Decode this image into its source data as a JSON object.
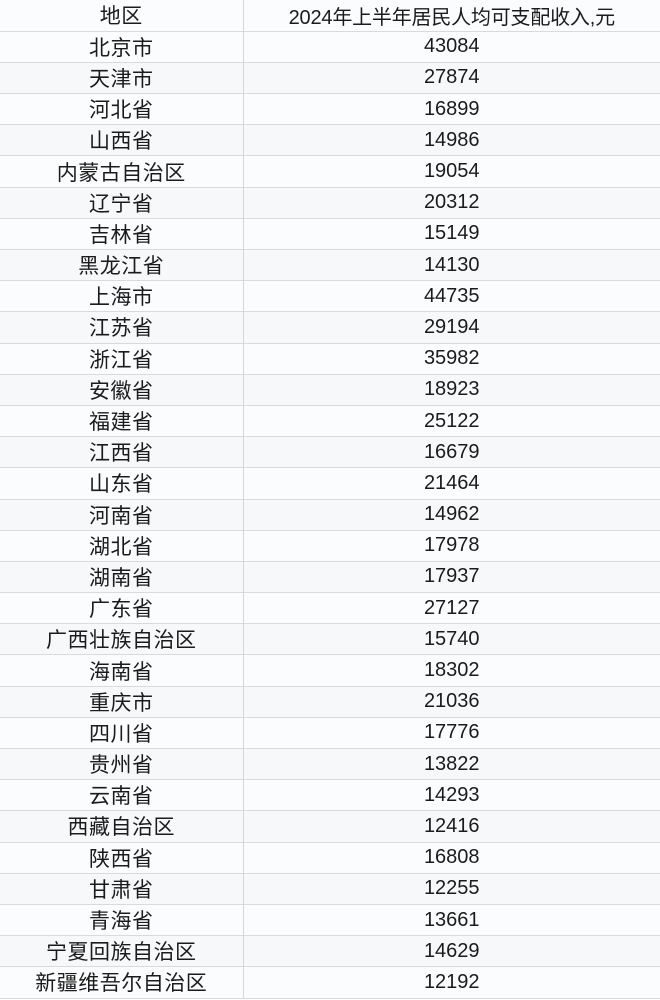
{
  "table": {
    "columns": [
      {
        "key": "region",
        "label": "地区"
      },
      {
        "key": "value",
        "label": "2024年上半年居民人均可支配收入,元"
      }
    ],
    "rows": [
      {
        "region": "北京市",
        "value": "43084"
      },
      {
        "region": "天津市",
        "value": "27874"
      },
      {
        "region": "河北省",
        "value": "16899"
      },
      {
        "region": "山西省",
        "value": "14986"
      },
      {
        "region": "内蒙古自治区",
        "value": "19054"
      },
      {
        "region": "辽宁省",
        "value": "20312"
      },
      {
        "region": "吉林省",
        "value": "15149"
      },
      {
        "region": "黑龙江省",
        "value": "14130"
      },
      {
        "region": "上海市",
        "value": "44735"
      },
      {
        "region": "江苏省",
        "value": "29194"
      },
      {
        "region": "浙江省",
        "value": "35982"
      },
      {
        "region": "安徽省",
        "value": "18923"
      },
      {
        "region": "福建省",
        "value": "25122"
      },
      {
        "region": "江西省",
        "value": "16679"
      },
      {
        "region": "山东省",
        "value": "21464"
      },
      {
        "region": "河南省",
        "value": "14962"
      },
      {
        "region": "湖北省",
        "value": "17978"
      },
      {
        "region": "湖南省",
        "value": "17937"
      },
      {
        "region": "广东省",
        "value": "27127"
      },
      {
        "region": "广西壮族自治区",
        "value": "15740"
      },
      {
        "region": "海南省",
        "value": "18302"
      },
      {
        "region": "重庆市",
        "value": "21036"
      },
      {
        "region": "四川省",
        "value": "17776"
      },
      {
        "region": "贵州省",
        "value": "13822"
      },
      {
        "region": "云南省",
        "value": "14293"
      },
      {
        "region": "西藏自治区",
        "value": "12416"
      },
      {
        "region": "陕西省",
        "value": "16808"
      },
      {
        "region": "甘肃省",
        "value": "12255"
      },
      {
        "region": "青海省",
        "value": "13661"
      },
      {
        "region": "宁夏回族自治区",
        "value": "14629"
      },
      {
        "region": "新疆维吾尔自治区",
        "value": "12192"
      }
    ]
  },
  "chart_data": {
    "type": "table",
    "title": "2024年上半年居民人均可支配收入,元",
    "categories": [
      "北京市",
      "天津市",
      "河北省",
      "山西省",
      "内蒙古自治区",
      "辽宁省",
      "吉林省",
      "黑龙江省",
      "上海市",
      "江苏省",
      "浙江省",
      "安徽省",
      "福建省",
      "江西省",
      "山东省",
      "河南省",
      "湖北省",
      "湖南省",
      "广东省",
      "广西壮族自治区",
      "海南省",
      "重庆市",
      "四川省",
      "贵州省",
      "云南省",
      "西藏自治区",
      "陕西省",
      "甘肃省",
      "青海省",
      "宁夏回族自治区",
      "新疆维吾尔自治区"
    ],
    "values": [
      43084,
      27874,
      16899,
      14986,
      19054,
      20312,
      15149,
      14130,
      44735,
      29194,
      35982,
      18923,
      25122,
      16679,
      21464,
      14962,
      17978,
      17937,
      27127,
      15740,
      18302,
      21036,
      17776,
      13822,
      14293,
      12416,
      16808,
      12255,
      13661,
      14629,
      12192
    ],
    "xlabel": "地区",
    "ylabel": "2024年上半年居民人均可支配收入,元",
    "unit": "元"
  },
  "colors": {
    "cell_background": "#fbfcfd",
    "cell_background_alt": "#f7f8fa",
    "gridline": "#d8dadd",
    "text": "#1b1b1b"
  }
}
